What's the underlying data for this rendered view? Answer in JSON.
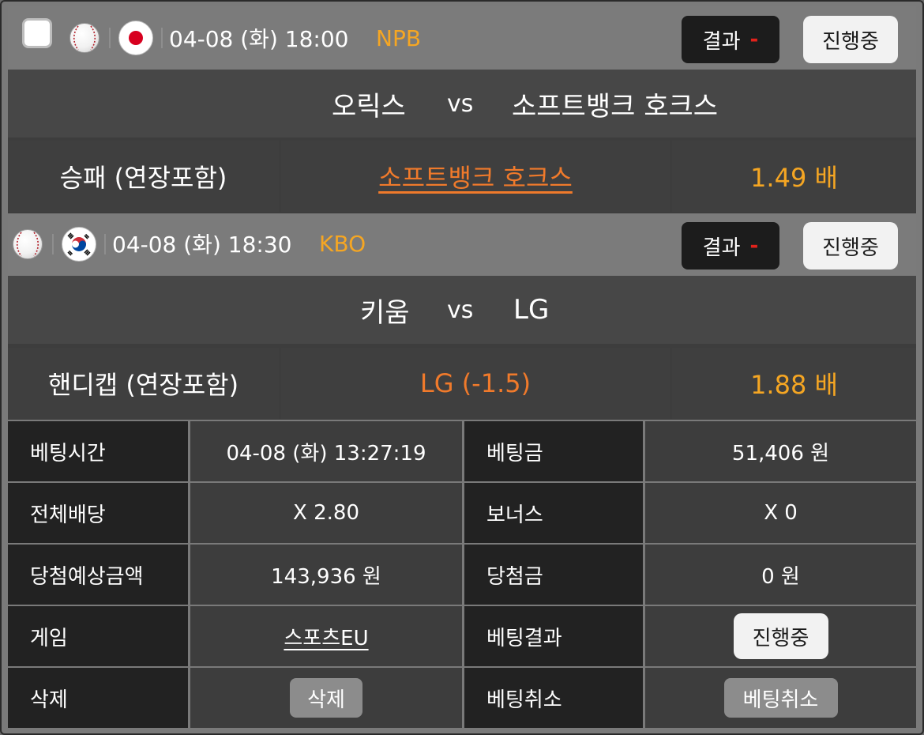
{
  "games": [
    {
      "date": "04-08 (화) 18:00",
      "league": "NPB",
      "flag_icon": "japan-flag-icon",
      "result_label": "결과",
      "result_value": "-",
      "status": "진행중",
      "home_team": "오릭스",
      "vs": "vs",
      "away_team": "소프트뱅크 호크스",
      "bet_type": "승패 (연장포함)",
      "pick": "소프트뱅크 호크스",
      "odds": "1.49 배"
    },
    {
      "date": "04-08 (화) 18:30",
      "league": "KBO",
      "flag_icon": "korea-flag-icon",
      "result_label": "결과",
      "result_value": "-",
      "status": "진행중",
      "home_team": "키움",
      "vs": "vs",
      "away_team": "LG",
      "bet_type": "핸디캡 (연장포함)",
      "pick": "LG  (-1.5)",
      "odds": "1.88 배"
    }
  ],
  "summary": {
    "bet_time_label": "베팅시간",
    "bet_time": "04-08 (화) 13:27:19",
    "bet_amount_label": "베팅금",
    "bet_amount": "51,406 원",
    "total_odds_label": "전체배당",
    "total_odds": "X 2.80",
    "bonus_label": "보너스",
    "bonus": "X 0",
    "expected_win_label": "당첨예상금액",
    "expected_win": "143,936 원",
    "win_amount_label": "당첨금",
    "win_amount": "0 원",
    "game_label": "게임",
    "game": "스포츠EU",
    "bet_result_label": "베팅결과",
    "bet_result": "진행중",
    "delete_label": "삭제",
    "delete_button": "삭제",
    "cancel_label": "베팅취소",
    "cancel_button": "베팅취소"
  },
  "colors": {
    "accent_orange": "#f5a623",
    "pick_orange": "#f07a2b",
    "result_red": "#e2221b",
    "badge_dark": "#1c1c1c",
    "label_bg": "#222222",
    "value_bg": "#3d3d3d"
  }
}
